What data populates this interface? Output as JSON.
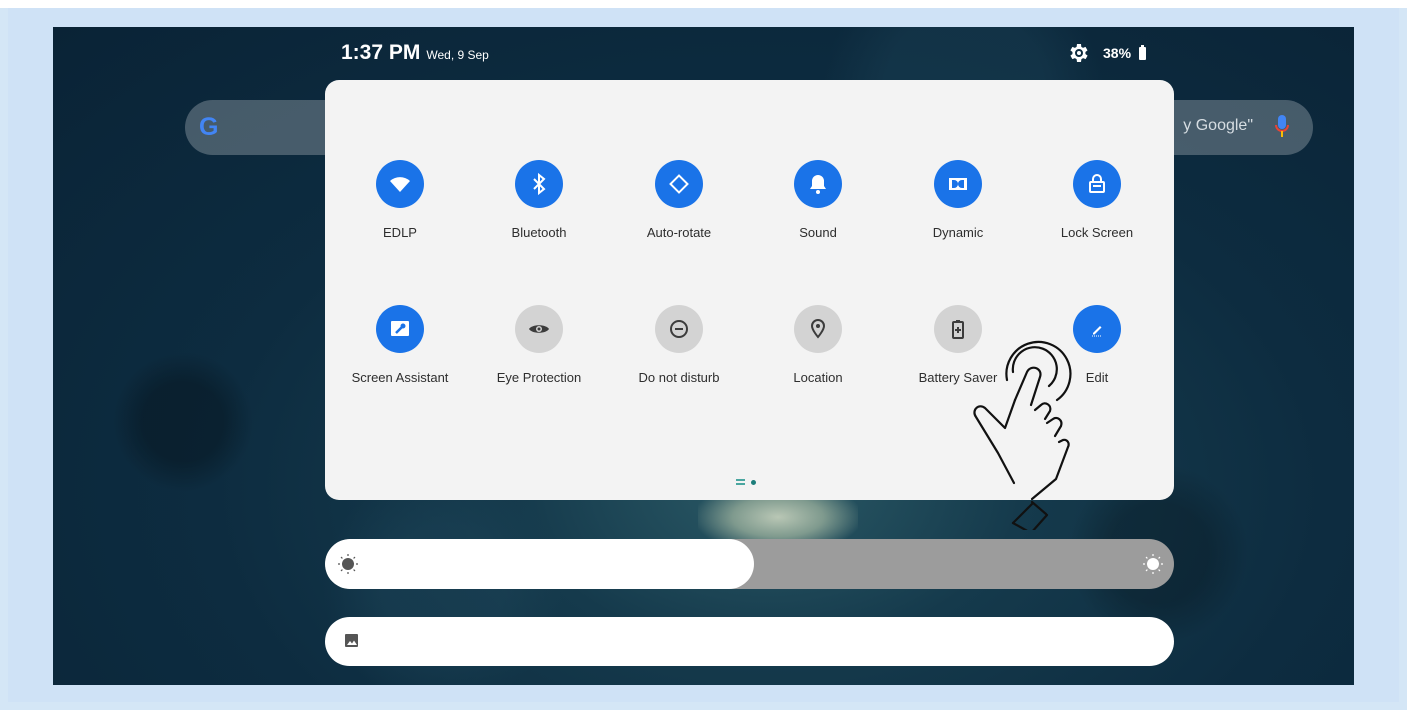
{
  "status_bar": {
    "time": "1:37 PM",
    "date": "Wed, 9 Sep",
    "battery": "38%"
  },
  "search": {
    "hint": "y Google\""
  },
  "quick_settings": {
    "tiles": [
      {
        "label": "EDLP",
        "icon": "wifi-icon",
        "state": "on"
      },
      {
        "label": "Bluetooth",
        "icon": "bluetooth-icon",
        "state": "on"
      },
      {
        "label": "Auto-rotate",
        "icon": "auto-rotate-icon",
        "state": "on"
      },
      {
        "label": "Sound",
        "icon": "bell-icon",
        "state": "on"
      },
      {
        "label": "Dynamic",
        "icon": "dolby-icon",
        "state": "on"
      },
      {
        "label": "Lock Screen",
        "icon": "lock-icon",
        "state": "on"
      },
      {
        "label": "Screen Assistant",
        "icon": "wrench-icon",
        "state": "on"
      },
      {
        "label": "Eye Protection",
        "icon": "eye-icon",
        "state": "off"
      },
      {
        "label": "Do not disturb",
        "icon": "minus-circle-icon",
        "state": "off"
      },
      {
        "label": "Location",
        "icon": "location-pin-icon",
        "state": "off"
      },
      {
        "label": "Battery Saver",
        "icon": "battery-plus-icon",
        "state": "off"
      },
      {
        "label": "Edit",
        "icon": "pencil-icon",
        "state": "on"
      }
    ],
    "page_count": 2,
    "current_page": 2
  },
  "brightness": {
    "level": 0.505
  },
  "colors": {
    "accent": "#1a73e8",
    "tile_off": "#d3d3d3",
    "panel": "#f3f3f3"
  },
  "annotation": {
    "icon": "tap-hand-icon"
  }
}
